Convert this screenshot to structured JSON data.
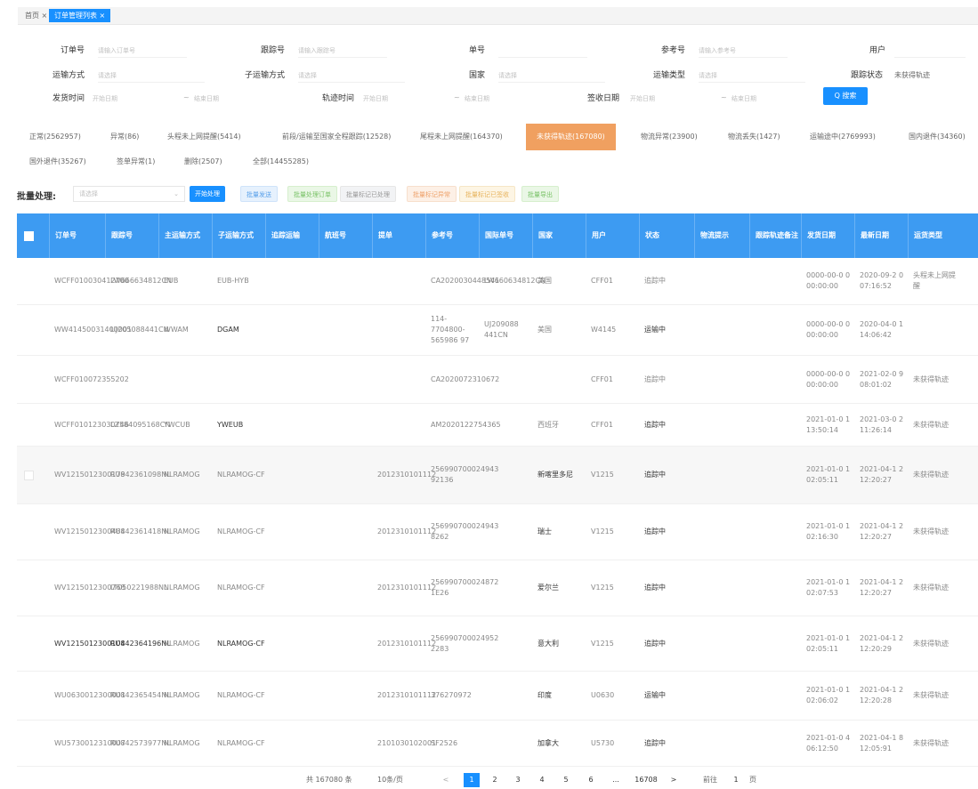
{
  "tabs": {
    "home_label": "首页",
    "home_close": "×",
    "active_label": "订单管理列表",
    "active_close": "×"
  },
  "filters": {
    "row1": [
      {
        "label": "订单号",
        "placeholder": "请输入订单号"
      },
      {
        "label": "跟踪号",
        "placeholder": "请输入跟踪号"
      },
      {
        "label": "单号",
        "placeholder": ""
      },
      {
        "label": "参考号",
        "placeholder": "请输入参考号"
      },
      {
        "label": "用户",
        "placeholder": ""
      }
    ],
    "row2": [
      {
        "label": "运输方式",
        "placeholder": "请选择"
      },
      {
        "label": "子运输方式",
        "placeholder": "请选择"
      },
      {
        "label": "国家",
        "placeholder": "请选择"
      },
      {
        "label": "运输类型",
        "placeholder": "请选择"
      },
      {
        "label": "跟踪状态",
        "value": "未获得轨迹"
      }
    ],
    "row3": [
      {
        "label": "发货时间",
        "start": "开始日期",
        "end": "结束日期"
      },
      {
        "label": "轨迹时间",
        "start": "开始日期",
        "end": "结束日期"
      },
      {
        "label": "签收日期",
        "start": "开始日期",
        "end": "结束日期"
      }
    ],
    "date_sep": "~",
    "search_label": "Q 搜索"
  },
  "status_tabs": [
    {
      "label": "正常(2562957)"
    },
    {
      "label": "异常(86)"
    },
    {
      "label": "头程未上网提醒(5414)"
    },
    {
      "label": "前段/运输至国家全程跟踪(12528)"
    },
    {
      "label": "尾程未上网提醒(164370)"
    },
    {
      "label": "未获得轨迹(167080)",
      "active": true
    },
    {
      "label": "物流异常(23900)"
    },
    {
      "label": "物流丢失(1427)"
    },
    {
      "label": "运输途中(2769993)"
    },
    {
      "label": "国内退件(34360)"
    },
    {
      "label": "国外退件(35267)"
    },
    {
      "label": "签单异常(1)"
    },
    {
      "label": "删除(2507)"
    },
    {
      "label": "全部(14455285)"
    }
  ],
  "batch": {
    "label": "批量处理:",
    "select_placeholder": "请选择",
    "buttons": [
      {
        "label": "开始处理",
        "style": "primary"
      },
      {
        "label": "批量发送",
        "style": "light-blue"
      },
      {
        "label": "批量处理订单",
        "style": "light-green"
      },
      {
        "label": "批量标记已处理",
        "style": "light-gray"
      },
      {
        "label": "批量标记异常",
        "style": "light-orange"
      },
      {
        "label": "批量标记已签收",
        "style": "light-yellow"
      },
      {
        "label": "批量导出",
        "style": "light-green"
      }
    ]
  },
  "table": {
    "columns": [
      "订单号",
      "跟踪号",
      "主运输方式",
      "子运输方式",
      "追踪运输",
      "航班号",
      "提单",
      "参考号",
      "国际单号",
      "国家",
      "用户",
      "状态",
      "物流提示",
      "跟踪轨迹备注",
      "发货日期",
      "最新日期",
      "运货类型"
    ],
    "rows": [
      {
        "c": [
          "WCFF010030412700",
          "LW666634812CN",
          "EUB",
          "EUB-HYB",
          "",
          "",
          "",
          "CA2020030448541",
          "LW660634812CN",
          "美国",
          "CFF01",
          "追踪中",
          "",
          "",
          "0000-00-0 0 00:00:00",
          "2020-09-2 0 07:16:52",
          "头程未上网提醒"
        ]
      },
      {
        "c": [
          "WW41450031400001",
          "UJ205088441CN",
          "WWAM",
          "DGAM",
          "",
          "",
          "",
          "114-7704800-565986 97",
          "UJ209088 441CN",
          "美国",
          "W4145",
          "运输中",
          "",
          "",
          "0000-00-0 0 00:00:00",
          "2020-04-0 1 14:06:42",
          ""
        ]
      },
      {
        "c": [
          "WCFF010072355202",
          "",
          "",
          "",
          "",
          "",
          "",
          "CA2020072310672",
          "",
          "",
          "CFF01",
          "追踪中",
          "",
          "",
          "0000-00-0 0 00:00:00",
          "2021-02-0 9 08:01:02",
          "未获得轨迹"
        ]
      },
      {
        "c": [
          "WCFF010123030746",
          "LZ584095168CN",
          "YWCUB",
          "YWEUB",
          "",
          "",
          "",
          "AM2020122754365",
          "",
          "西班牙",
          "CFF01",
          "追踪中",
          "",
          "",
          "2021-01-0 1 13:50:14",
          "2021-03-0 2 11:26:14",
          "未获得轨迹"
        ]
      },
      {
        "c": [
          "WV1215012300179",
          "RU842361098NL",
          "NLRAMOG",
          "NLRAMOG-CF",
          "",
          "",
          "2012310101112",
          "256990700024943 92136",
          "",
          "新喀里多尼",
          "V1215",
          "追踪中",
          "",
          "",
          "2021-01-0 1 02:05:11",
          "2021-04-1 2 12:20:27",
          "未获得轨迹"
        ]
      },
      {
        "c": [
          "WV1215012300484",
          "RU842361418NL",
          "NLRAMOG",
          "NLRAMOG-CF",
          "",
          "",
          "2012310101112",
          "256990700024943 8262",
          "",
          "瑞士",
          "V1215",
          "追踪中",
          "",
          "",
          "2021-01-0 1 02:16:30",
          "2021-04-1 2 12:20:27",
          "未获得轨迹"
        ]
      },
      {
        "c": [
          "WV1215012300768",
          "LT050221988NL",
          "NLRAMOG",
          "NLRAMOG-CF",
          "",
          "",
          "2012310101112",
          "256990700024872 1E26",
          "",
          "爱尔兰",
          "V1215",
          "追踪中",
          "",
          "",
          "2021-01-0 1 02:07:53",
          "2021-04-1 2 12:20:27",
          "未获得轨迹"
        ]
      },
      {
        "c": [
          "WV1215012300104",
          "RU842364196NL",
          "NLRAMOG",
          "NLRAMOG-CF",
          "",
          "",
          "2012310101112",
          "256990700024952 2283",
          "",
          "意大利",
          "V1215",
          "追踪中",
          "",
          "",
          "2021-01-0 1 02:05:11",
          "2021-04-1 2 12:20:29",
          "未获得轨迹"
        ]
      },
      {
        "c": [
          "WU0630012300001",
          "RU842365454NL",
          "NLRAMOG",
          "NLRAMOG-CF",
          "",
          "",
          "2012310101112",
          "376270972",
          "",
          "印度",
          "U0630",
          "运输中",
          "",
          "",
          "2021-01-0 1 02:06:02",
          "2021-04-1 2 12:20:28",
          "未获得轨迹"
        ]
      },
      {
        "c": [
          "WU5730012310007",
          "RU842573977NL",
          "NLRAMOG",
          "NLRAMOG-CF",
          "",
          "",
          "2101030102001",
          "SF2526",
          "",
          "加拿大",
          "U5730",
          "追踪中",
          "",
          "",
          "2021-01-0 4 06:12:50",
          "2021-04-1 8 12:05:91",
          "未获得轨迹"
        ]
      }
    ]
  },
  "pagination": {
    "total": "共 167080 条",
    "page_size": "10条/页",
    "prev": "<",
    "pages": [
      "1",
      "2",
      "3",
      "4",
      "5",
      "6"
    ],
    "ellipsis": "...",
    "last": "16708",
    "next": ">",
    "goto": "前往",
    "goto_value": "1",
    "goto_unit": "页"
  }
}
